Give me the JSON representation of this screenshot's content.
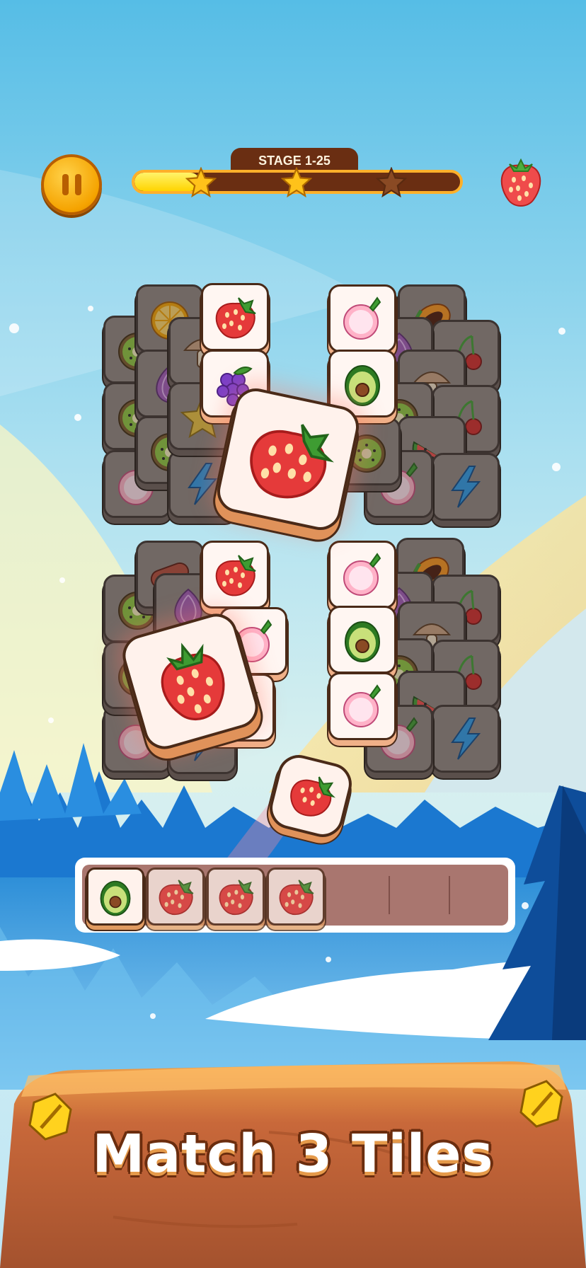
{
  "hud": {
    "stage_label": "STAGE 1-25",
    "progress": 0.2,
    "stars": [
      "filled",
      "filled",
      "empty"
    ],
    "target_fruit": "strawberry-icon"
  },
  "board": {
    "highlighted_tiles": [
      "strawberry",
      "strawberry",
      "strawberry"
    ],
    "tile_types": [
      "strawberry",
      "grape",
      "avocado",
      "radish",
      "kiwi",
      "orange",
      "papaya",
      "watermelon",
      "onion",
      "mushroom",
      "star-fruit",
      "lightning",
      "sausage",
      "cherry"
    ]
  },
  "tray": {
    "slots_total": 7,
    "slots": [
      "avocado",
      "strawberry",
      "strawberry",
      "strawberry",
      "",
      "",
      ""
    ]
  },
  "banner": {
    "title": "Match 3 Tiles"
  },
  "colors": {
    "sky_top": "#5ec0e8",
    "accent": "#ffb02a",
    "banner_wood": "#c9703a",
    "strawberry": "#e53a3a"
  }
}
